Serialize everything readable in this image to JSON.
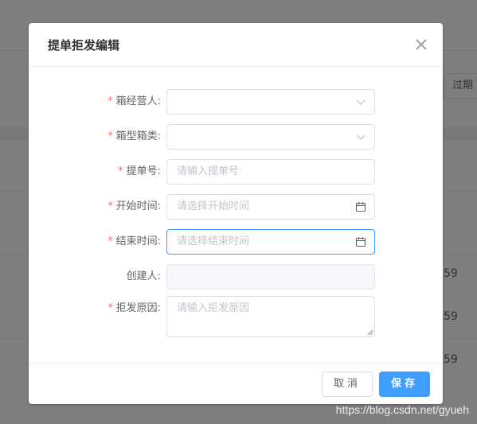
{
  "background": {
    "filter_button_label": "过期",
    "table_cells": [
      "59",
      "59",
      "59"
    ]
  },
  "dialog": {
    "title": "提单拒发编辑",
    "fields": [
      {
        "label": "箱经营人:",
        "required": true,
        "type": "select",
        "value": "",
        "placeholder": ""
      },
      {
        "label": "箱型箱类:",
        "required": true,
        "type": "select",
        "value": "",
        "placeholder": ""
      },
      {
        "label": "提单号:",
        "required": true,
        "type": "input",
        "value": "",
        "placeholder": "请输入提单号"
      },
      {
        "label": "开始时间:",
        "required": true,
        "type": "date",
        "value": "",
        "placeholder": "请选择开始时间"
      },
      {
        "label": "结束时间:",
        "required": true,
        "type": "date",
        "value": "",
        "placeholder": "请选择结束时间"
      },
      {
        "label": "创建人:",
        "required": false,
        "type": "disabled",
        "value": "",
        "placeholder": ""
      },
      {
        "label": "拒发原因:",
        "required": true,
        "type": "textarea",
        "value": "",
        "placeholder": "请输入拒发原因"
      }
    ],
    "required_mark": "*",
    "cancel_label": "取消",
    "save_label": "保存"
  },
  "watermark": "https://blog.csdn.net/gyueh",
  "colors": {
    "primary": "#409eff",
    "required": "#f56c6c",
    "overlay": "rgba(0,0,0,0.5)"
  }
}
